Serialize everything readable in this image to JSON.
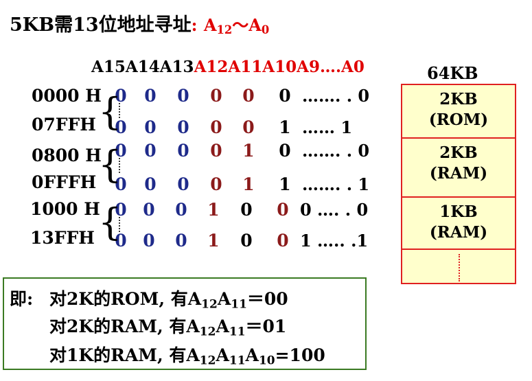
{
  "title": {
    "main": "5KB需13位地址寻址",
    "colon": ":",
    "range": {
      "a": "A",
      "a_sub": "12",
      "tilde": "～",
      "b": "A",
      "b_sub": "0"
    }
  },
  "header": {
    "black_part": "A15A14A13",
    "red_part": "A12A11A10A9….A0"
  },
  "rows": [
    {
      "addr": "0000 H",
      "bits": [
        "0",
        "0",
        "0",
        "0",
        "0",
        "0"
      ],
      "tail": "……. . 0"
    },
    {
      "addr": "07FFH",
      "bits": [
        "0",
        "0",
        "0",
        "0",
        "0",
        "1"
      ],
      "tail": "……    1"
    },
    {
      "addr": "0800 H",
      "bits": [
        "0",
        "0",
        "0",
        "0",
        "1",
        "0"
      ],
      "tail": "……. . 0"
    },
    {
      "addr": "0FFFH",
      "bits": [
        "0",
        "0",
        "0",
        "0",
        "1",
        "1"
      ],
      "tail": "……. . 1"
    },
    {
      "addr": "1000 H",
      "bits": [
        "0",
        "0",
        "0",
        "1",
        "0",
        "0"
      ],
      "tail": "0 …. . 0"
    },
    {
      "addr": "13FFH",
      "bits": [
        "0",
        "0",
        "0",
        "1",
        "0",
        "0"
      ],
      "tail": "1 ….. .1"
    }
  ],
  "memory": {
    "title": "64KB",
    "blocks": [
      {
        "size": "2KB",
        "type": "(ROM)"
      },
      {
        "size": "2KB",
        "type": "(RAM)"
      },
      {
        "size": "1KB",
        "type": "(RAM)"
      }
    ]
  },
  "summary": {
    "prefix": "即:",
    "lines": [
      {
        "text": "对2K的ROM, 有A",
        "s1": "12",
        "m": "A",
        "s2": "11",
        "eq": "＝00"
      },
      {
        "text": "对2K的RAM, 有A",
        "s1": "12",
        "m": "A",
        "s2": "11",
        "eq": "＝01"
      },
      {
        "text": "对1K的RAM, 有A",
        "s1": "12",
        "m": "A",
        "s2": "11",
        "m2": "A",
        "s3": "10",
        "eq": "=100"
      }
    ]
  },
  "colors": {
    "red": "#e00000",
    "blue": "#1e2a8a",
    "dark_red": "#8b1a1a",
    "box_border": "#3a7a22",
    "mem_fill": "#ffffcc"
  }
}
